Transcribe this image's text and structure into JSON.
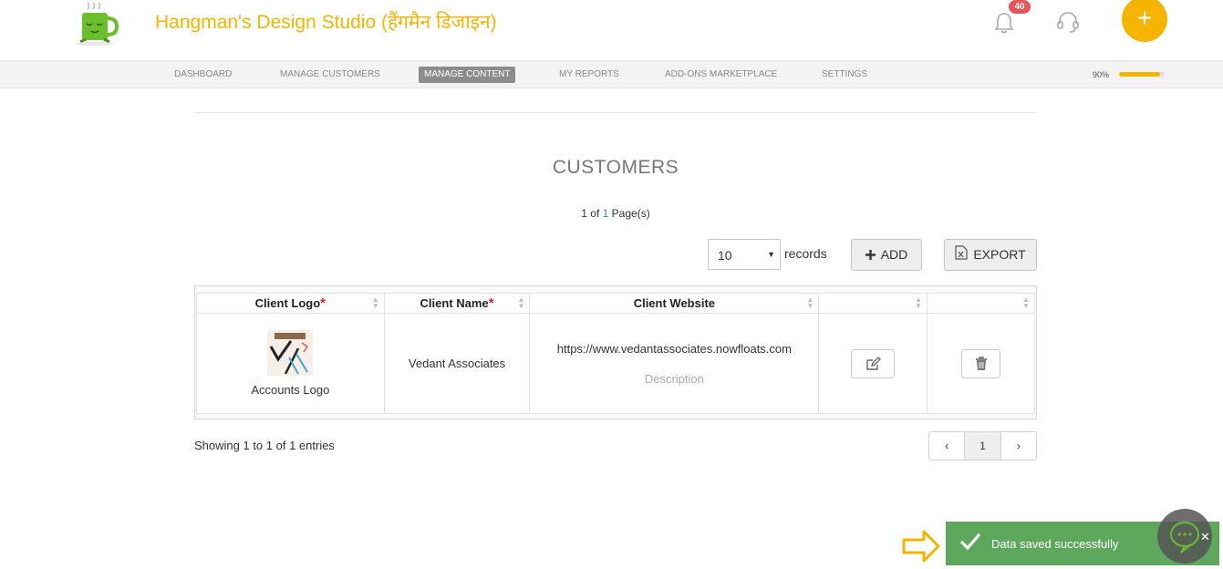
{
  "header": {
    "brand": "Hangman's Design Studio (हैंगमैन डिजाइन)",
    "notification_count": "40",
    "fab_label": "+"
  },
  "nav": {
    "items": [
      "DASHBOARD",
      "MANAGE CUSTOMERS",
      "MANAGE CONTENT",
      "MY REPORTS",
      "ADD-ONS MARKETPLACE",
      "SETTINGS"
    ],
    "active": "MANAGE CONTENT",
    "progress_label": "90%",
    "progress_value": 0.9
  },
  "main": {
    "title": "CUSTOMERS",
    "pages_prefix": "1 of",
    "pages_num": "1",
    "pages_suffix": "Page(s)",
    "records_value": "10",
    "records_label": "records",
    "add_label": "ADD",
    "export_label": "EXPORT"
  },
  "table": {
    "headers": [
      "Client Logo",
      "Client Name",
      "Client Website"
    ],
    "required_mark": "*",
    "rows": [
      {
        "logo_caption": "Accounts Logo",
        "name": "Vedant Associates",
        "website": "https://www.vedantassociates.nowfloats.com",
        "description": "Description"
      }
    ]
  },
  "footer": {
    "showing": "Showing 1 to 1 of 1 entries",
    "pager_prev": "‹",
    "pager_current": "1",
    "pager_next": "›"
  },
  "toast": {
    "message": "Data saved successfully",
    "close": "✕"
  },
  "colors": {
    "brand": "#f5b400",
    "toast": "#5ea85e",
    "badge": "#e8545a"
  }
}
